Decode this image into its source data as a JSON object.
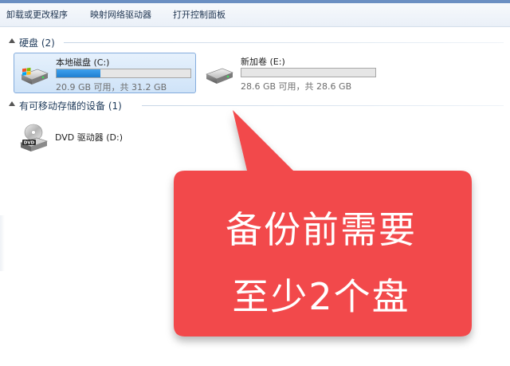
{
  "toolbar": {
    "items": [
      "卸载或更改程序",
      "映射网络驱动器",
      "打开控制面板"
    ]
  },
  "sections": {
    "hard_disks": {
      "title": "硬盘 (2)"
    },
    "removable": {
      "title": "有可移动存储的设备 (1)"
    }
  },
  "drives": {
    "c": {
      "name": "本地磁盘 (C:)",
      "space": "20.9 GB 可用，共 31.2 GB",
      "used_fraction": 0.33
    },
    "e": {
      "name": "新加卷 (E:)",
      "space": "28.6 GB 可用，共 28.6 GB",
      "used_fraction": 0.0
    }
  },
  "dvd": {
    "name": "DVD 驱动器 (D:)",
    "icon_label": "DVD"
  },
  "callout": {
    "line1": "备份前需要",
    "line2": "至少2个盘",
    "color": "#f2484b"
  },
  "icons": {
    "drive": "hard-drive-icon",
    "dvd": "dvd-drive-icon",
    "expand": "section-collapse-arrow-icon"
  }
}
